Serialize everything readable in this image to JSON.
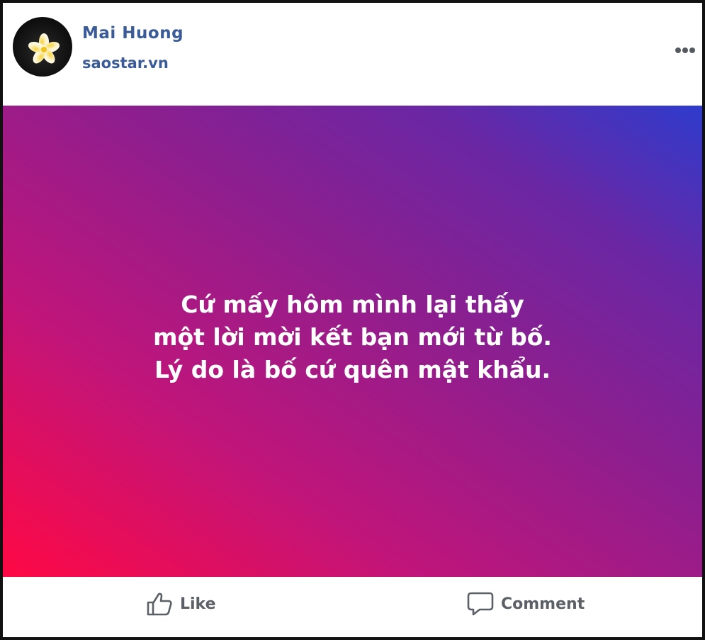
{
  "post": {
    "author": {
      "name": "Mai Huong",
      "source": "saostar.vn",
      "avatar_icon": "plumeria-flower-icon"
    },
    "more_icon": "more-options-icon",
    "background": {
      "gradient_start": "#ff0844",
      "gradient_end": "#2e3bcc"
    },
    "text_lines": [
      "Cứ mấy hôm mình lại thấy",
      "một lời mời kết bạn mới từ bố.",
      "Lý do là bố cứ quên mật khẩu."
    ],
    "actions": {
      "like_label": "Like",
      "like_icon": "thumbs-up-icon",
      "comment_label": "Comment",
      "comment_icon": "speech-bubble-icon"
    }
  }
}
